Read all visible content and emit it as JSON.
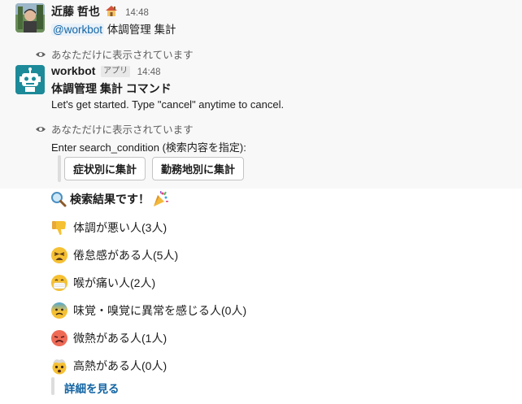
{
  "user_message": {
    "author": "近藤 哲也",
    "time": "14:48",
    "mention": "@workbot",
    "text": "体調管理 集計"
  },
  "ephemeral_notice_1": "あなただけに表示されています",
  "bot_message": {
    "author": "workbot",
    "badge": "アプリ",
    "time": "14:48",
    "heading": "体調管理 集計 コマンド",
    "body": "Let's get started. Type \"cancel\" anytime to cancel."
  },
  "ephemeral_notice_2": "あなただけに表示されています",
  "prompt": "Enter search_condition (検索内容を指定):",
  "buttons": {
    "by_symptom": "症状別に集計",
    "by_location": "勤務地別に集計"
  },
  "results": {
    "heading": "検索結果です！",
    "items": [
      {
        "emoji": "thumbs-down-icon",
        "text": "体調が悪い人(3人)"
      },
      {
        "emoji": "weary-face-icon",
        "text": "倦怠感がある人(5人)"
      },
      {
        "emoji": "mask-face-icon",
        "text": "喉が痛い人(2人)"
      },
      {
        "emoji": "cold-sweat-face-icon",
        "text": "味覚・嗅覚に異常を感じる人(0人)"
      },
      {
        "emoji": "flushed-face-icon",
        "text": "微熱がある人(1人)"
      },
      {
        "emoji": "exploding-head-icon",
        "text": "高熱がある人(0人)"
      }
    ],
    "details_link": "詳細を見る"
  },
  "colors": {
    "link": "#1264a3",
    "mention_bg": "#e8f1fa",
    "bot_avatar": "#1d8a99",
    "ephemeral_bg": "#f8f8f8"
  }
}
